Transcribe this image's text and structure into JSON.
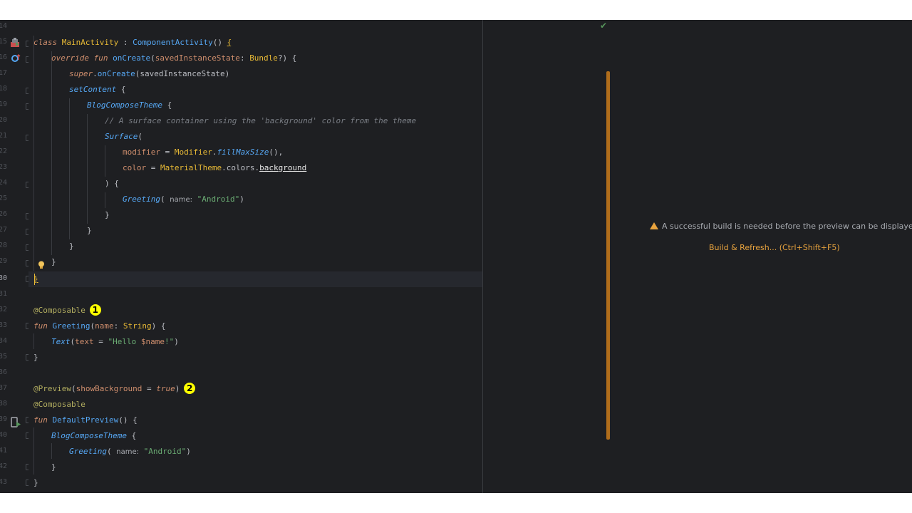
{
  "gutter": {
    "line_numbers": [
      "14",
      "15",
      "16",
      "17",
      "18",
      "19",
      "20",
      "21",
      "22",
      "23",
      "24",
      "25",
      "26",
      "27",
      "28",
      "29",
      "30",
      "31",
      "32",
      "33",
      "34",
      "35",
      "36",
      "37",
      "38",
      "39",
      "40",
      "41",
      "42",
      "43"
    ],
    "current_line": "30",
    "icons": [
      "run-activity-icon",
      "override-marker-icon",
      "lightbulb-icon",
      "preview-run-icon"
    ]
  },
  "code": {
    "l15": [
      "class",
      "MainActivity",
      " : ",
      "ComponentActivity",
      "() ",
      "{"
    ],
    "l16": [
      "override",
      " ",
      "fun",
      " ",
      "onCreate",
      "(",
      "savedInstanceState",
      ": ",
      "Bundle",
      "?) {"
    ],
    "l17": [
      "super",
      ".",
      "onCreate",
      "(savedInstanceState)"
    ],
    "l18": [
      "setContent",
      " {"
    ],
    "l19": [
      "BlogComposeTheme",
      " {"
    ],
    "l20": [
      "// A surface container using the 'background' color from the theme"
    ],
    "l21": [
      "Surface",
      "("
    ],
    "l22": [
      "modifier",
      " = ",
      "Modifier",
      ".",
      "fillMaxSize",
      "(),"
    ],
    "l23": [
      "color",
      " = ",
      "MaterialTheme",
      ".colors.",
      "background"
    ],
    "l24": [
      ") {"
    ],
    "l25": [
      "Greeting",
      "( ",
      "name:",
      " ",
      "\"Android\"",
      ")"
    ],
    "l26": [
      "}"
    ],
    "l27": [
      "}"
    ],
    "l28": [
      "}"
    ],
    "l29": [
      "}"
    ],
    "l30": [
      "}"
    ],
    "l32": [
      "@Composable"
    ],
    "l33": [
      "fun",
      " ",
      "Greeting",
      "(",
      "name",
      ": ",
      "String",
      ") {"
    ],
    "l34": [
      "Text",
      "(",
      "text",
      " = ",
      "\"Hello ",
      "$name",
      "!\"",
      ")"
    ],
    "l35": [
      "}"
    ],
    "l37": [
      "@Preview",
      "(",
      "showBackground",
      " = ",
      "true",
      ")"
    ],
    "l38": [
      "@Composable"
    ],
    "l39": [
      "fun",
      " ",
      "DefaultPreview",
      "() {"
    ],
    "l40": [
      "BlogComposeTheme",
      " {"
    ],
    "l41": [
      "Greeting",
      "( ",
      "name:",
      " ",
      "\"Android\"",
      ")"
    ],
    "l42": [
      "}"
    ],
    "l43": [
      "}"
    ]
  },
  "badges": {
    "composable_badge": "1",
    "preview_badge": "2"
  },
  "preview_panel": {
    "status_icon": "check-icon",
    "message": "A successful build is needed before the preview can be displayed",
    "build_link": "Build & Refresh... (Ctrl+Shift+F5)"
  },
  "colors": {
    "background": "#1e1f22",
    "keyword": "#cf8e6d",
    "function": "#56a8f5",
    "string": "#6aab73",
    "annotation": "#b3ae60",
    "badge": "#ffff00",
    "warning": "#e8a33e"
  }
}
